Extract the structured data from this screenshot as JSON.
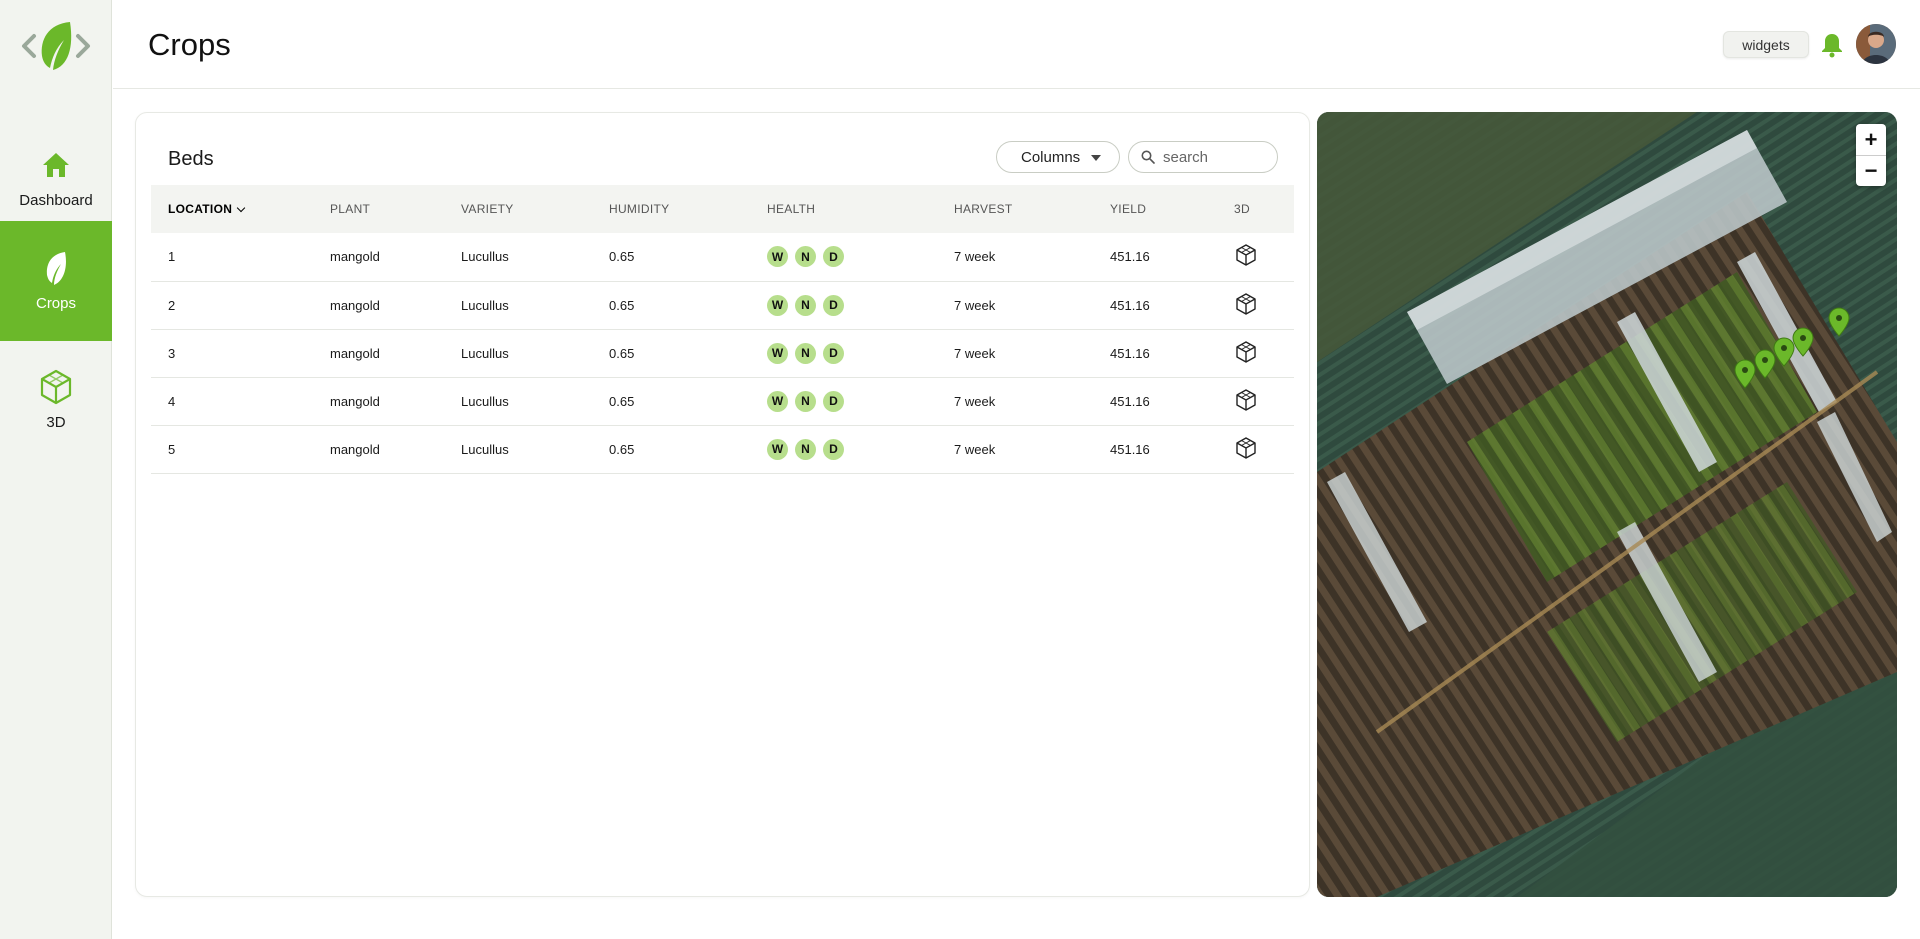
{
  "app": {
    "page_title": "Crops",
    "accent_color": "#6bb82a",
    "badge_color": "#b7de8c"
  },
  "sidebar": {
    "items": [
      {
        "label": "Dashboard",
        "icon": "home-icon",
        "active": false
      },
      {
        "label": "Crops",
        "icon": "leaf-icon",
        "active": true
      },
      {
        "label": "3D",
        "icon": "cube-icon",
        "active": false
      }
    ]
  },
  "header": {
    "widgets_label": "widgets",
    "notification_icon": "bell-icon",
    "avatar": "user-avatar"
  },
  "beds": {
    "title": "Beds",
    "columns_button": "Columns",
    "search_placeholder": "search",
    "headers": [
      "LOCATION",
      "PLANT",
      "VARIETY",
      "HUMIDITY",
      "HEALTH",
      "HARVEST",
      "YIELD",
      "3D"
    ],
    "sorted_column": "LOCATION",
    "health_labels": [
      "W",
      "N",
      "D"
    ],
    "rows": [
      {
        "location": "1",
        "plant": "mangold",
        "variety": "Lucullus",
        "humidity": "0.65",
        "harvest": "7 week",
        "yield": "451.16"
      },
      {
        "location": "2",
        "plant": "mangold",
        "variety": "Lucullus",
        "humidity": "0.65",
        "harvest": "7 week",
        "yield": "451.16"
      },
      {
        "location": "3",
        "plant": "mangold",
        "variety": "Lucullus",
        "humidity": "0.65",
        "harvest": "7 week",
        "yield": "451.16"
      },
      {
        "location": "4",
        "plant": "mangold",
        "variety": "Lucullus",
        "humidity": "0.65",
        "harvest": "7 week",
        "yield": "451.16"
      },
      {
        "location": "5",
        "plant": "mangold",
        "variety": "Lucullus",
        "humidity": "0.65",
        "harvest": "7 week",
        "yield": "451.16"
      }
    ]
  },
  "map": {
    "zoom_in": "+",
    "zoom_out": "−",
    "markers": 5
  }
}
